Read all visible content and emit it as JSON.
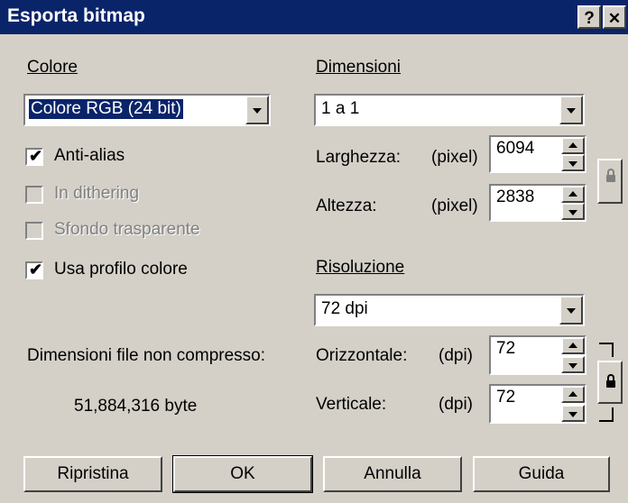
{
  "window": {
    "title": "Esporta bitmap",
    "help_btn": "?",
    "close_btn": "✕"
  },
  "color_section": {
    "label": "Colore",
    "combo_value": "Colore RGB (24 bit)",
    "options": [
      {
        "label": "Anti-alias",
        "checked": true,
        "enabled": true
      },
      {
        "label": "In dithering",
        "checked": false,
        "enabled": false
      },
      {
        "label": "Sfondo trasparente",
        "checked": false,
        "enabled": false
      },
      {
        "label": "Usa profilo colore",
        "checked": true,
        "enabled": true
      }
    ]
  },
  "file_size": {
    "label": "Dimensioni file non compresso:",
    "value": "51,884,316 byte"
  },
  "dimensions": {
    "label": "Dimensioni",
    "combo_value": "1 a 1",
    "width_label": "Larghezza:",
    "width_unit": "(pixel)",
    "width_value": "6094",
    "height_label": "Altezza:",
    "height_unit": "(pixel)",
    "height_value": "2838"
  },
  "resolution": {
    "label": "Risoluzione",
    "combo_value": "72 dpi",
    "horizontal_label": "Orizzontale:",
    "horizontal_unit": "(dpi)",
    "horizontal_value": "72",
    "vertical_label": "Verticale:",
    "vertical_unit": "(dpi)",
    "vertical_value": "72"
  },
  "buttons": {
    "reset": "Ripristina",
    "ok": "OK",
    "cancel": "Annulla",
    "help": "Guida"
  }
}
